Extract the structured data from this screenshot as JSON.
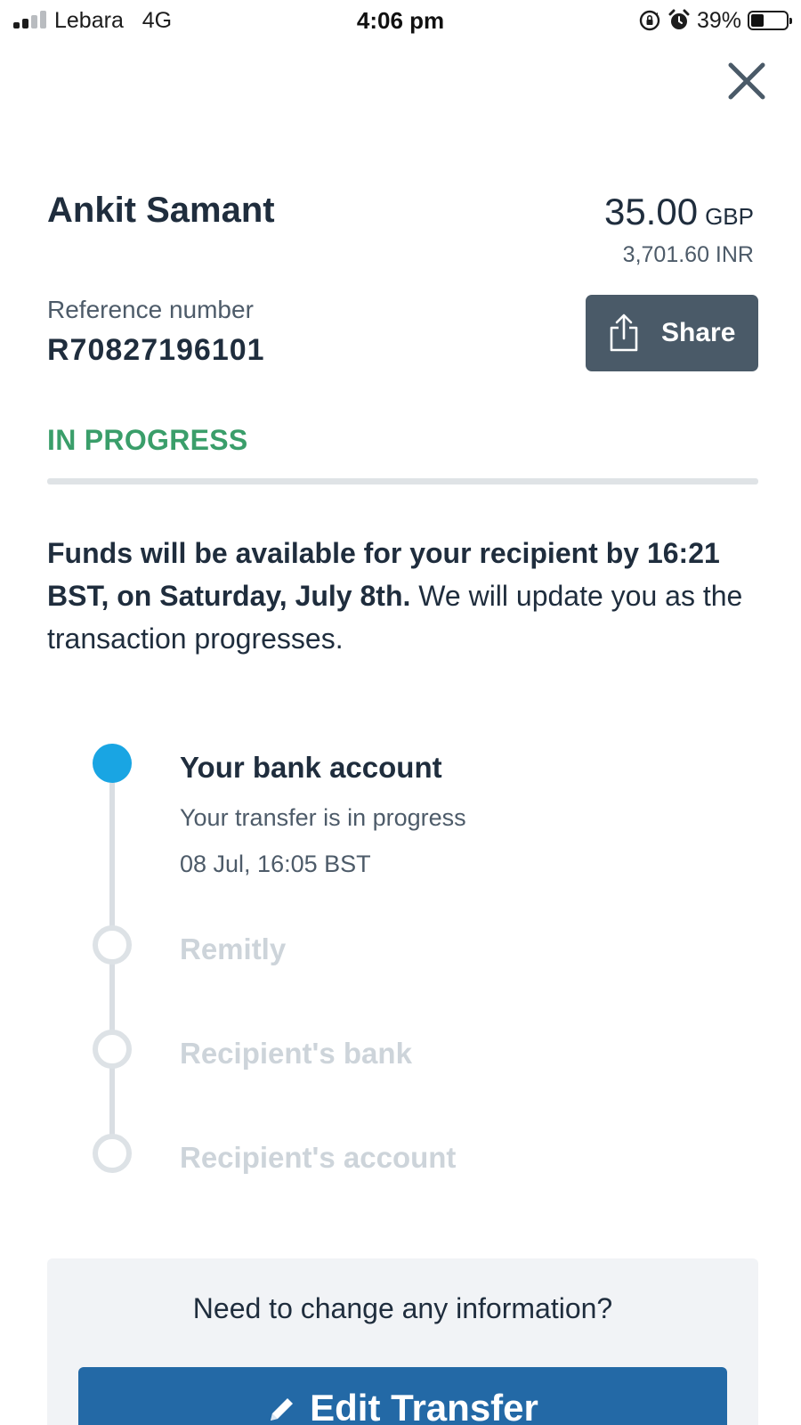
{
  "status_bar": {
    "carrier": "Lebara",
    "network": "4G",
    "time": "4:06 pm",
    "battery": "39%",
    "battery_level": 0.39
  },
  "transfer": {
    "recipient_name": "Ankit Samant",
    "amount": "35.00",
    "amount_currency": "GBP",
    "converted_amount": "3,701.60 INR",
    "reference_label": "Reference number",
    "reference_number": "R70827196101",
    "share_label": "Share",
    "status": "IN PROGRESS",
    "status_color": "#3a9e6a",
    "message_bold": "Funds will be available for your recipient by 16:21 BST, on Saturday, July 8th.",
    "message_rest": " We will update you as the transaction progresses."
  },
  "timeline": {
    "steps": [
      {
        "title": "Your bank account",
        "detail": "Your transfer is in progress",
        "time": "08 Jul, 16:05 BST",
        "state": "active"
      },
      {
        "title": "Remitly",
        "state": "pending"
      },
      {
        "title": "Recipient's bank",
        "state": "pending"
      },
      {
        "title": "Recipient's account",
        "state": "pending"
      }
    ],
    "active_color": "#19a5e3"
  },
  "help": {
    "question": "Need to change any information?",
    "edit_label": "Edit Transfer",
    "button_color": "#2369a6"
  },
  "icons": {
    "close": "close-icon",
    "share": "share-icon",
    "edit": "pencil-icon"
  }
}
